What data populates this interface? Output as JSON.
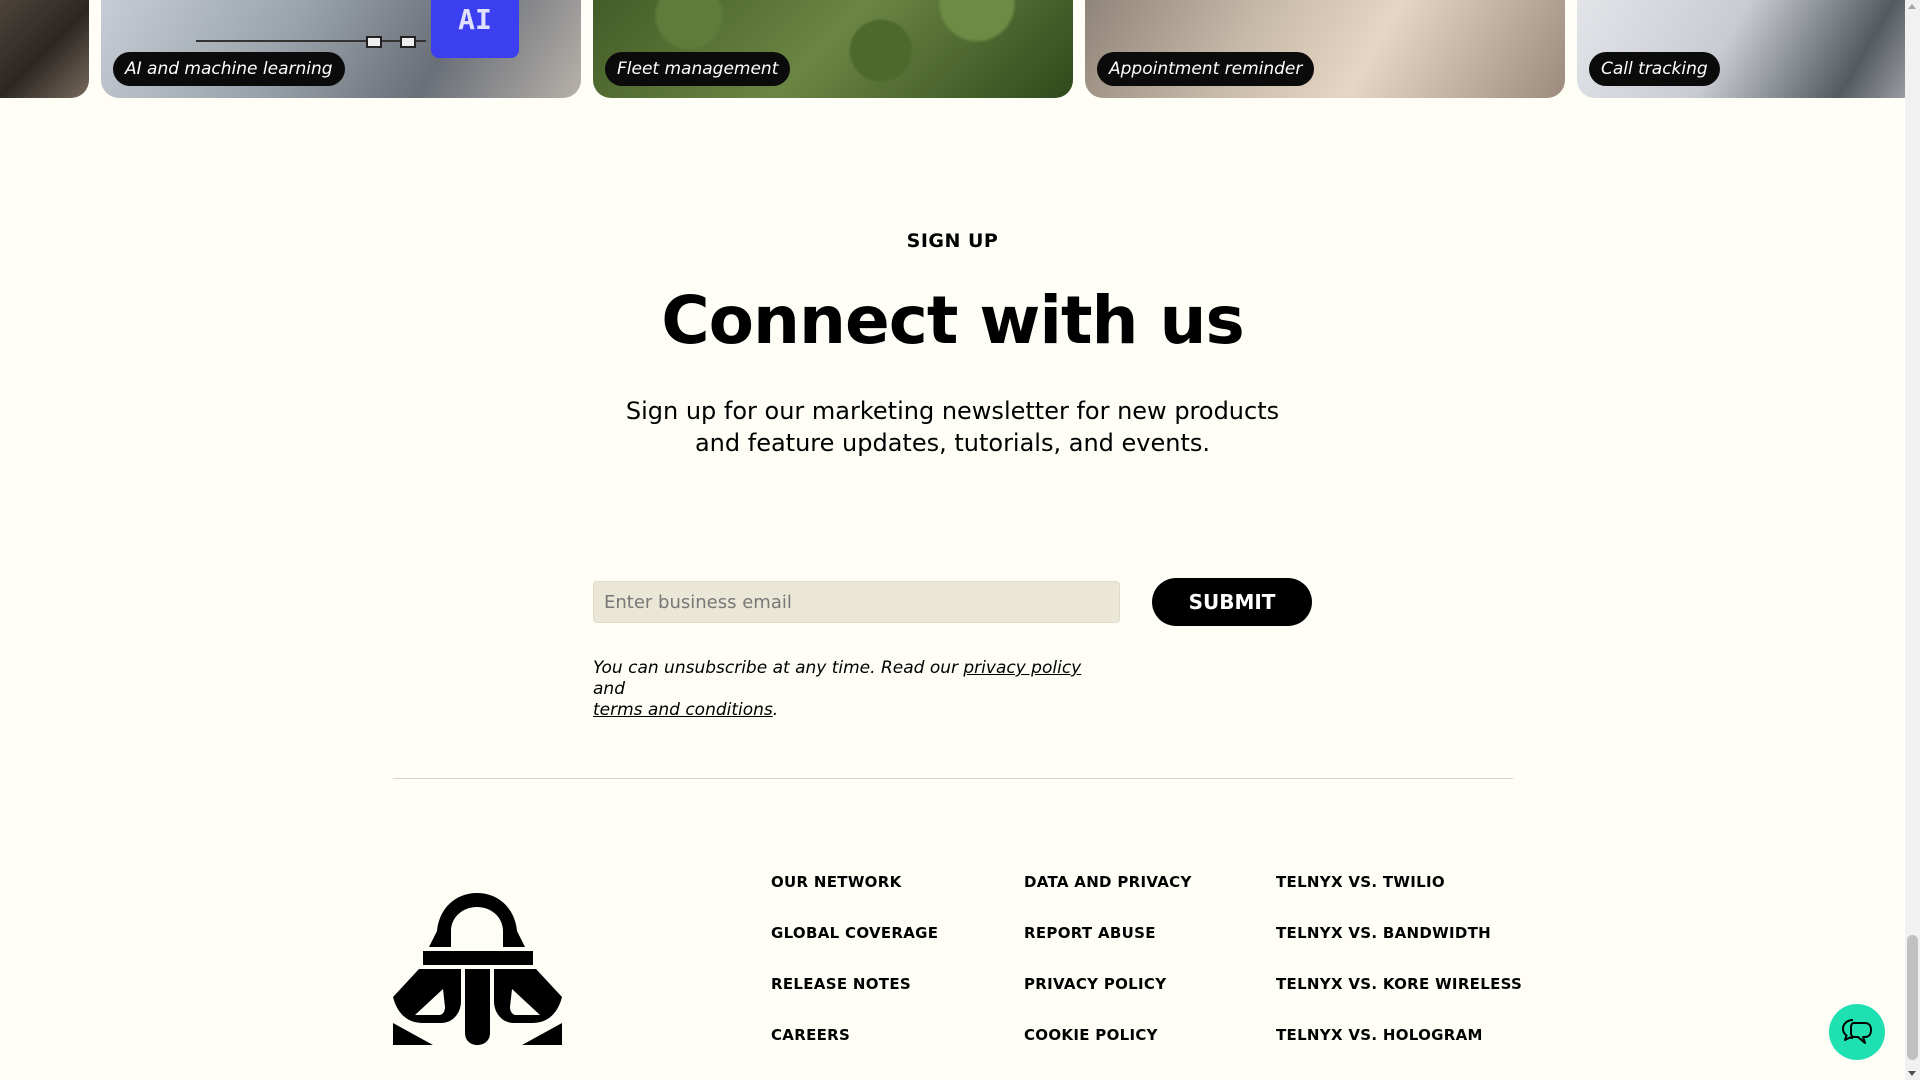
{
  "carousel": {
    "cards": [
      {
        "label": ""
      },
      {
        "label": "AI and machine learning",
        "chip_text": "AI"
      },
      {
        "label": "Fleet management"
      },
      {
        "label": "Appointment reminder"
      },
      {
        "label": "Call tracking"
      }
    ]
  },
  "signup": {
    "eyebrow": "SIGN UP",
    "heading": "Connect with us",
    "description": "Sign up for our marketing newsletter for new products and feature updates, tutorials, and events.",
    "email_placeholder": "Enter business email",
    "submit_label": "SUBMIT",
    "legal_prefix": "You can unsubscribe at any time. Read our ",
    "privacy_link": "privacy policy",
    "legal_middle": " and ",
    "terms_link": "terms and conditions",
    "legal_suffix": "."
  },
  "footer": {
    "columns": [
      [
        "OUR NETWORK",
        "GLOBAL COVERAGE",
        "RELEASE NOTES",
        "CAREERS"
      ],
      [
        "DATA AND PRIVACY",
        "REPORT ABUSE",
        "PRIVACY POLICY",
        "COOKIE POLICY"
      ],
      [
        "TELNYX VS. TWILIO",
        "TELNYX VS. BANDWIDTH",
        "TELNYX VS. KORE WIRELESS",
        "TELNYX VS. HOLOGRAM"
      ]
    ]
  },
  "colors": {
    "background": "#fefdf6",
    "accent": "#1fe0b0",
    "button": "#000000"
  },
  "icons": {
    "chat": "chat-bubbles-icon",
    "logo": "telnyx-logo"
  }
}
